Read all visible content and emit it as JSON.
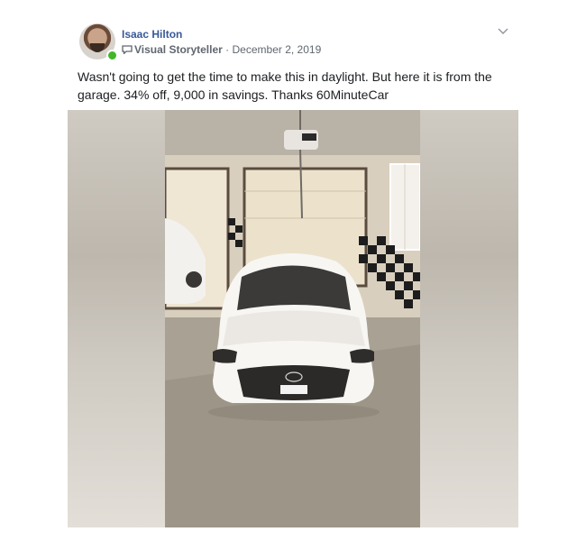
{
  "post": {
    "author": "Isaac Hilton",
    "badge_label": "Visual Storyteller",
    "separator": "·",
    "date": "December 2, 2019",
    "text": "Wasn't going to get the time to make this in daylight. But here it is from the garage. 34% off, 9,000 in savings. Thanks 60MinuteCar",
    "online_status_color": "#42b72a",
    "name_color": "#385898",
    "icons": {
      "badge": "speech-bubble-icon",
      "menu": "chevron-down-icon"
    }
  }
}
